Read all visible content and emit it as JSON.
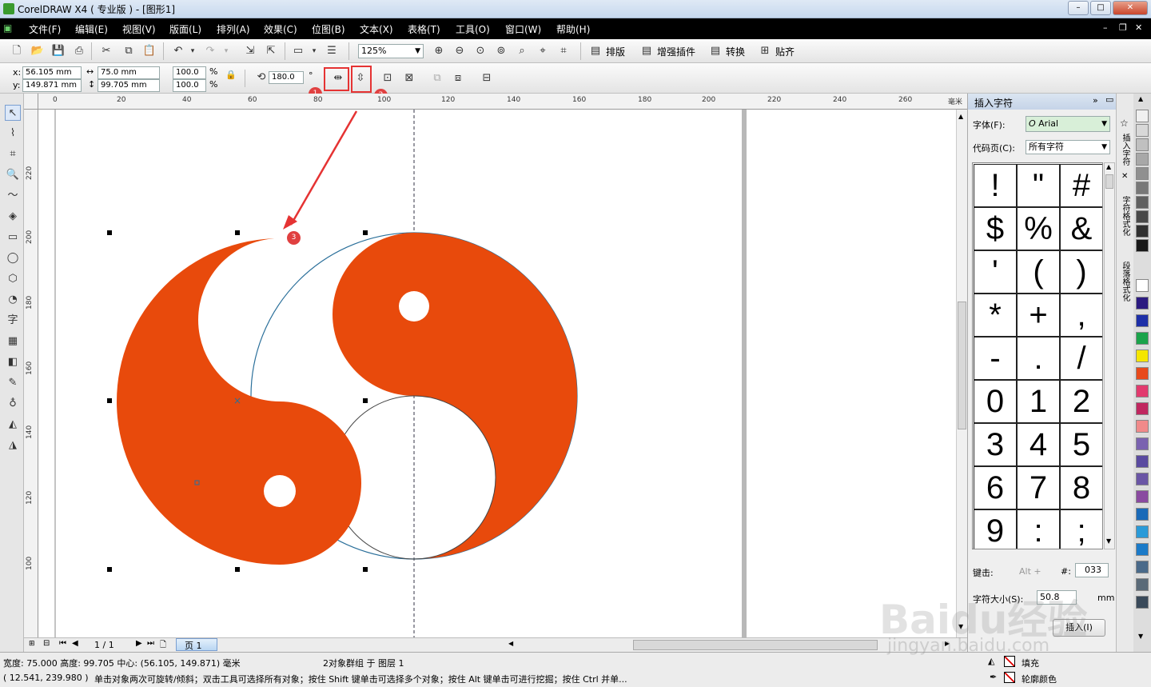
{
  "titlebar": {
    "title": "CorelDRAW X4 ( 专业版 ) - [图形1]",
    "minimize": "0",
    "maximize": "1",
    "close": "r"
  },
  "menu": [
    "文件(F)",
    "编辑(E)",
    "视图(V)",
    "版面(L)",
    "排列(A)",
    "效果(C)",
    "位图(B)",
    "文本(X)",
    "表格(T)",
    "工具(O)",
    "窗口(W)",
    "帮助(H)"
  ],
  "toolbar": {
    "zoom": "125%",
    "btn_layout": "排版",
    "btn_plugin": "增强插件",
    "btn_convert": "转换",
    "btn_snap": "贴齐"
  },
  "propbar": {
    "x": "56.105 mm",
    "y": "149.871 mm",
    "w": "75.0 mm",
    "h": "99.705 mm",
    "sx": "100.0",
    "sy": "100.0",
    "pct": "%",
    "angle": "180.0",
    "deg": "°",
    "x_label": "x:",
    "y_label": "y:"
  },
  "annotations": [
    "1",
    "2",
    "3"
  ],
  "ruler_h": [
    "0",
    "20",
    "40",
    "60",
    "80",
    "100",
    "120",
    "140",
    "160",
    "180",
    "200",
    "220",
    "240",
    "260"
  ],
  "ruler_h_unit": "毫米",
  "ruler_v": [
    "220",
    "200",
    "180",
    "160",
    "140",
    "120",
    "100"
  ],
  "pager": {
    "count": "1 / 1",
    "page_tab": "页 1"
  },
  "docker": {
    "title": "插入字符",
    "font_label": "字体(F):",
    "font_value": "Arial",
    "codepage_label": "代码页(C):",
    "codepage_value": "所有字符",
    "chars": [
      "!",
      "\"",
      "#",
      "$",
      "%",
      "&",
      "'",
      "(",
      ")",
      "*",
      "+",
      ",",
      "-",
      ".",
      "/",
      "0",
      "1",
      "2",
      "3",
      "4",
      "5",
      "6",
      "7",
      "8",
      "9",
      ":",
      ";"
    ],
    "key_label": "键击:",
    "alt_label": "Alt +",
    "hash_label": "#:",
    "code": "033",
    "size_label": "字符大小(S):",
    "size_value": "50.8",
    "unit": "mm",
    "insert_btn": "插入(I)"
  },
  "docker_tabs": [
    "插入字符",
    "字符格式化",
    "段落格式化"
  ],
  "palette": [
    "#ffffff",
    "#2b1a80",
    "#1d2fa8",
    "#1aa34a",
    "#f5e600",
    "#e84a1b",
    "#e23a6e",
    "#c0275f",
    "#f08a8a",
    "#7a62b0",
    "#5a4aa0",
    "#6a55a5",
    "#8a4aa0",
    "#1a6ab8",
    "#2a9ad8",
    "#1a7ac8",
    "#4a6a8a",
    "#5a6a78",
    "#3a4a5a"
  ],
  "grays": [
    "#f0f0f0",
    "#d8d8d8",
    "#c0c0c0",
    "#a8a8a8",
    "#909090",
    "#787878",
    "#606060",
    "#484848",
    "#303030",
    "#181818"
  ],
  "status": {
    "dims": "宽度: 75.000  高度: 99.705  中心: (56.105, 149.871)  毫米",
    "group": "2对象群组 于 图层 1",
    "coords": "( 12.541, 239.980 )",
    "hint": "单击对象两次可旋转/倾斜；双击工具可选择所有对象；按住 Shift 键单击可选择多个对象；按住 Alt 键单击可进行挖掘；按住 Ctrl 并单...",
    "fill": "填充",
    "outline": "轮廓颜色"
  },
  "watermark": {
    "main": "Baidu经验",
    "sub": "jingyan.baidu.com"
  },
  "colors": {
    "shape": "#e84a0c",
    "accent": "#e53333"
  }
}
